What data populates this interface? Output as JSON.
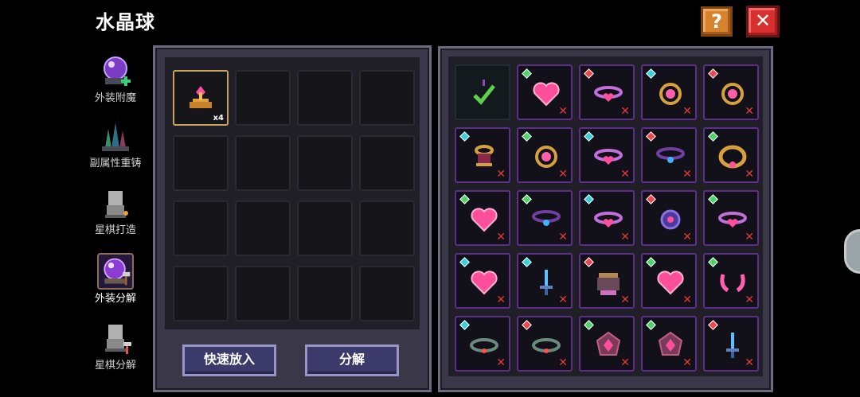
{
  "header": {
    "title": "水晶球",
    "help_label": "?",
    "close_label": "✕"
  },
  "sidebar": {
    "items": [
      {
        "label": "外装附魔",
        "icon": "crystal-ball-plus-icon",
        "active": false
      },
      {
        "label": "副属性重铸",
        "icon": "crystal-cluster-icon",
        "active": false
      },
      {
        "label": "星棋打造",
        "icon": "statue-forge-icon",
        "active": false
      },
      {
        "label": "外装分解",
        "icon": "crystal-ball-hammer-icon",
        "active": true
      },
      {
        "label": "星棋分解",
        "icon": "statue-hammer-icon",
        "active": false
      }
    ]
  },
  "left_panel": {
    "slots": [
      {
        "icon": "pink-gem-crown-icon",
        "qty": "x4"
      },
      null,
      null,
      null,
      null,
      null,
      null,
      null,
      null,
      null,
      null,
      null,
      null,
      null,
      null,
      null
    ],
    "quick_add_label": "快速放入",
    "decompose_label": "分解"
  },
  "right_panel": {
    "items": [
      {
        "icon": "checkmark-icon",
        "rarity": null,
        "selected": true
      },
      {
        "icon": "pink-heart-icon",
        "rarity": "green"
      },
      {
        "icon": "heart-collar-icon",
        "rarity": "red"
      },
      {
        "icon": "gold-ring-pink-gem-icon",
        "rarity": "cyan"
      },
      {
        "icon": "gold-ring-pink-gem-icon",
        "rarity": "red"
      },
      {
        "icon": "gold-cup-ring-icon",
        "rarity": "cyan"
      },
      {
        "icon": "gold-ring-pink-gem-icon",
        "rarity": "green"
      },
      {
        "icon": "heart-collar-icon",
        "rarity": "cyan"
      },
      {
        "icon": "blue-gem-collar-icon",
        "rarity": "red"
      },
      {
        "icon": "gold-bracelet-icon",
        "rarity": "green"
      },
      {
        "icon": "pink-heart-icon",
        "rarity": "green"
      },
      {
        "icon": "blue-gem-collar-icon",
        "rarity": "green"
      },
      {
        "icon": "heart-collar-icon",
        "rarity": "cyan"
      },
      {
        "icon": "blue-orb-icon",
        "rarity": "red"
      },
      {
        "icon": "heart-collar-icon",
        "rarity": "green"
      },
      {
        "icon": "pink-heart-icon",
        "rarity": "cyan"
      },
      {
        "icon": "blue-sword-icon",
        "rarity": "cyan"
      },
      {
        "icon": "pink-cauldron-icon",
        "rarity": "red"
      },
      {
        "icon": "pink-heart-icon",
        "rarity": "green"
      },
      {
        "icon": "pink-horns-icon",
        "rarity": "green"
      },
      {
        "icon": "spiked-collar-icon",
        "rarity": "cyan"
      },
      {
        "icon": "spiked-collar-icon",
        "rarity": "red"
      },
      {
        "icon": "pink-crystal-shield-icon",
        "rarity": "green"
      },
      {
        "icon": "pink-crystal-shield-icon",
        "rarity": "green"
      },
      {
        "icon": "blue-sword-icon",
        "rarity": "red"
      }
    ],
    "remove_symbol": "✕"
  },
  "colors": {
    "rarity_green": "#4fd26a",
    "rarity_red": "#e8484f",
    "rarity_cyan": "#3ad0d8",
    "item_border": "#5d2f88",
    "slot_border_filled": "#c8a45a"
  }
}
